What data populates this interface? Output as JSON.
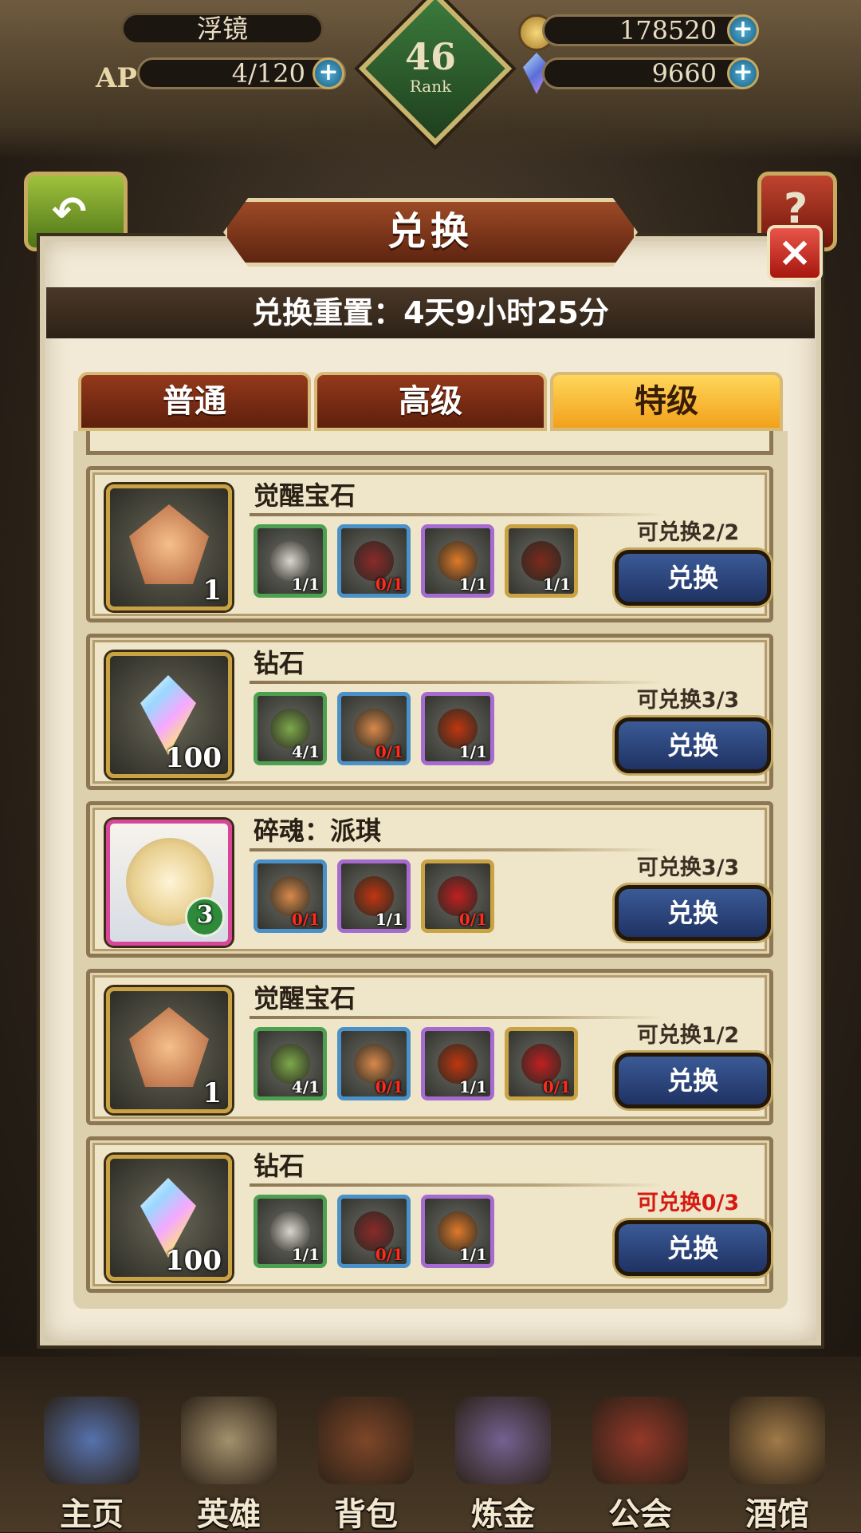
{
  "hud": {
    "player_name": "浮镜",
    "ap_label": "AP",
    "ap": "4/120",
    "rank_number": "46",
    "rank_label": "Rank",
    "gold": "178520",
    "gems": "9660"
  },
  "dialog": {
    "title": "兑换",
    "close_symbol": "×",
    "reset_text": "兑换重置：4天9小时25分",
    "tabs": [
      {
        "label": "普通",
        "active": false
      },
      {
        "label": "高级",
        "active": false
      },
      {
        "label": "特级",
        "active": true
      }
    ],
    "button_label": "兑换"
  },
  "rows": [
    {
      "reward_name": "觉醒宝石",
      "reward_qty": "1",
      "reward_icon": "awakening-gem-icon",
      "availability": "可兑换2/2",
      "availability_color": "#3a2f22",
      "materials": [
        {
          "icon": "newspaper-icon",
          "rarity": "green",
          "count": "1/1",
          "insufficient": false
        },
        {
          "icon": "leather-collar-icon",
          "rarity": "blue",
          "count": "0/1",
          "insufficient": true
        },
        {
          "icon": "potion-bottle-icon",
          "rarity": "purple",
          "count": "1/1",
          "insufficient": false
        },
        {
          "icon": "flintlock-pistol-icon",
          "rarity": "gold",
          "count": "1/1",
          "insufficient": false
        }
      ]
    },
    {
      "reward_name": "钻石",
      "reward_qty": "100",
      "reward_icon": "diamond-icon",
      "availability": "可兑换3/3",
      "availability_color": "#3a2f22",
      "materials": [
        {
          "icon": "fish-on-leaf-icon",
          "rarity": "green",
          "count": "4/1",
          "insufficient": false
        },
        {
          "icon": "bread-bun-icon",
          "rarity": "blue",
          "count": "0/1",
          "insufficient": true
        },
        {
          "icon": "roast-bean-icon",
          "rarity": "purple",
          "count": "1/1",
          "insufficient": false
        }
      ]
    },
    {
      "reward_name": "碎魂：派琪",
      "reward_qty": "3",
      "reward_icon": "hero-soul-portrait",
      "availability": "可兑换3/3",
      "availability_color": "#3a2f22",
      "materials": [
        {
          "icon": "bread-bun-icon",
          "rarity": "blue",
          "count": "0/1",
          "insufficient": true
        },
        {
          "icon": "roast-bean-icon",
          "rarity": "purple",
          "count": "1/1",
          "insufficient": false
        },
        {
          "icon": "red-herb-icon",
          "rarity": "gold",
          "count": "0/1",
          "insufficient": true
        }
      ]
    },
    {
      "reward_name": "觉醒宝石",
      "reward_qty": "1",
      "reward_icon": "awakening-gem-icon",
      "availability": "可兑换1/2",
      "availability_color": "#3a2f22",
      "materials": [
        {
          "icon": "fish-on-leaf-icon",
          "rarity": "green",
          "count": "4/1",
          "insufficient": false
        },
        {
          "icon": "bread-bun-icon",
          "rarity": "blue",
          "count": "0/1",
          "insufficient": true
        },
        {
          "icon": "roast-bean-icon",
          "rarity": "purple",
          "count": "1/1",
          "insufficient": false
        },
        {
          "icon": "red-herb-icon",
          "rarity": "gold",
          "count": "0/1",
          "insufficient": true
        }
      ]
    },
    {
      "reward_name": "钻石",
      "reward_qty": "100",
      "reward_icon": "diamond-icon",
      "availability": "可兑换0/3",
      "availability_color": "#d61a12",
      "materials": [
        {
          "icon": "newspaper-icon",
          "rarity": "green",
          "count": "1/1",
          "insufficient": false
        },
        {
          "icon": "leather-collar-icon",
          "rarity": "blue",
          "count": "0/1",
          "insufficient": true
        },
        {
          "icon": "potion-bottle-icon",
          "rarity": "purple",
          "count": "1/1",
          "insufficient": false
        }
      ]
    }
  ],
  "nav": [
    {
      "label": "主页",
      "icon": "castle-icon"
    },
    {
      "label": "英雄",
      "icon": "winged-helmet-icon"
    },
    {
      "label": "背包",
      "icon": "backpack-icon"
    },
    {
      "label": "炼金",
      "icon": "alchemy-flask-icon"
    },
    {
      "label": "公会",
      "icon": "guild-crest-icon"
    },
    {
      "label": "酒馆",
      "icon": "tavern-barrel-icon"
    }
  ],
  "colors": {
    "rarity_green": "#4da04f",
    "rarity_blue": "#4a91c9",
    "rarity_purple": "#a66bd1",
    "rarity_gold": "#c9a243",
    "count_insufficient": "#ff2b1c",
    "tab_active": "#f2a11a",
    "tab_inactive": "#6e2711"
  }
}
